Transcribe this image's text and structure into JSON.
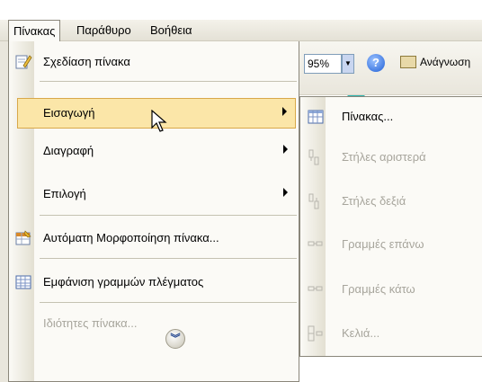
{
  "menubar": {
    "items": [
      {
        "label": "Πίνακας",
        "active": true
      },
      {
        "label": "Παράθυρο",
        "active": false
      },
      {
        "label": "Βοήθεια",
        "active": false
      }
    ]
  },
  "toolbar": {
    "zoom_value": "95%",
    "read_label": "Ανάγνωση"
  },
  "table_menu": {
    "items": [
      {
        "label": "Σχεδίαση πίνακα",
        "icon": "pencil-icon",
        "submenu": false,
        "enabled": true
      },
      {
        "label": "Εισαγωγή",
        "icon": "",
        "submenu": true,
        "enabled": true,
        "highlighted": true
      },
      {
        "label": "Διαγραφή",
        "icon": "",
        "submenu": true,
        "enabled": true
      },
      {
        "label": "Επιλογή",
        "icon": "",
        "submenu": true,
        "enabled": true
      },
      {
        "label": "Αυτόματη Μορφοποίηση πίνακα...",
        "icon": "autoformat-icon",
        "submenu": false,
        "enabled": true
      },
      {
        "label": "Εμφάνιση γραμμών πλέγματος",
        "icon": "gridlines-icon",
        "submenu": false,
        "enabled": true
      },
      {
        "label": "Ιδιότητες πίνακα...",
        "icon": "",
        "submenu": false,
        "enabled": false
      }
    ],
    "expand_icon": "double-chevron-down-icon"
  },
  "insert_submenu": {
    "items": [
      {
        "label": "Πίνακας...",
        "icon": "table-icon",
        "enabled": true
      },
      {
        "label": "Στήλες αριστερά",
        "icon": "columns-left-icon",
        "enabled": false
      },
      {
        "label": "Στήλες δεξιά",
        "icon": "columns-right-icon",
        "enabled": false
      },
      {
        "label": "Γραμμές επάνω",
        "icon": "rows-above-icon",
        "enabled": false
      },
      {
        "label": "Γραμμές κάτω",
        "icon": "rows-below-icon",
        "enabled": false
      },
      {
        "label": "Κελιά...",
        "icon": "cells-icon",
        "enabled": false
      }
    ]
  },
  "colors": {
    "highlight": "#fbe6a8",
    "callout_arrow": "#2bb3b0",
    "disabled_text": "#a7a59c"
  }
}
